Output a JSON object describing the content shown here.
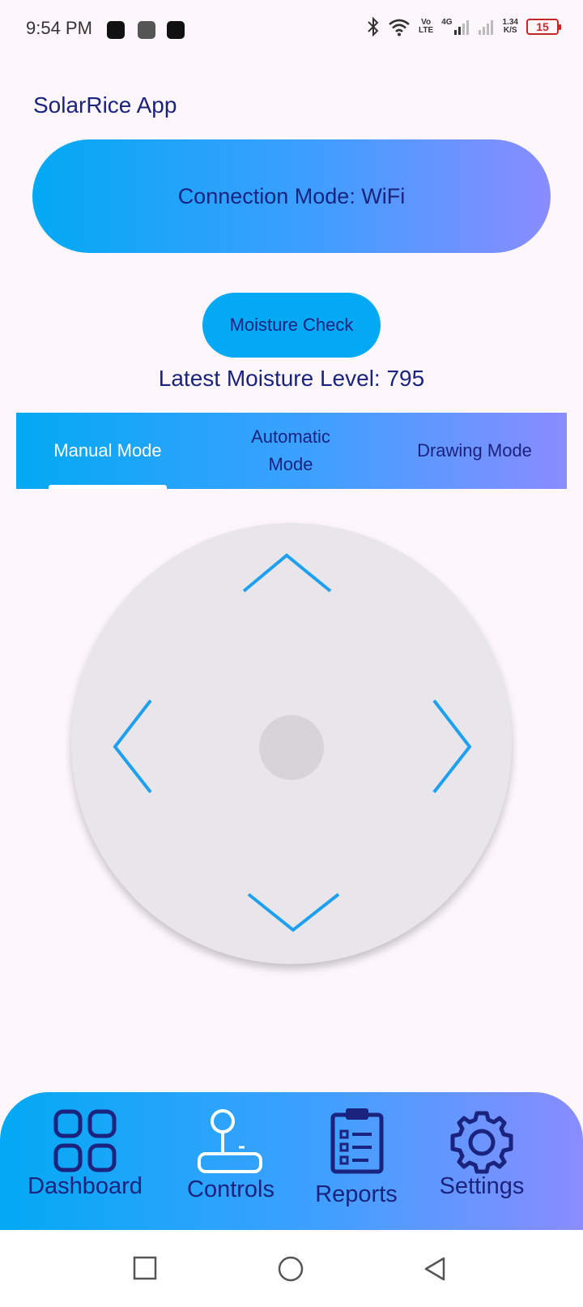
{
  "status_bar": {
    "time": "9:54 PM",
    "net_volte_top": "Vo",
    "net_volte_bottom": "LTE",
    "net_4g": "4G",
    "speed_value": "1.34",
    "speed_unit": "K/S",
    "battery": "15",
    "battery_color": "#c62828"
  },
  "app": {
    "title": "SolarRice App"
  },
  "connection": {
    "label": "Connection Mode: WiFi"
  },
  "moisture": {
    "button_label": "Moisture Check",
    "level_text": "Latest Moisture Level: 795"
  },
  "tabs": [
    {
      "label": "Manual Mode",
      "selected": true
    },
    {
      "label": "Automatic Mode",
      "selected": false
    },
    {
      "label": "Drawing Mode",
      "selected": false
    }
  ],
  "dpad": {
    "icons": [
      "chevron-up-icon",
      "chevron-left-icon",
      "chevron-right-icon",
      "chevron-down-icon"
    ],
    "accent": "#1ea0f0"
  },
  "bottom_nav": [
    {
      "label": "Dashboard",
      "icon": "grid-icon"
    },
    {
      "label": "Controls",
      "icon": "joystick-icon"
    },
    {
      "label": "Reports",
      "icon": "clipboard-icon"
    },
    {
      "label": "Settings",
      "icon": "gear-icon"
    }
  ],
  "colors": {
    "accent": "#03a9f4",
    "text": "#1a237e",
    "gradient_end": "#8a8cff",
    "background": "#fdf7fc"
  }
}
